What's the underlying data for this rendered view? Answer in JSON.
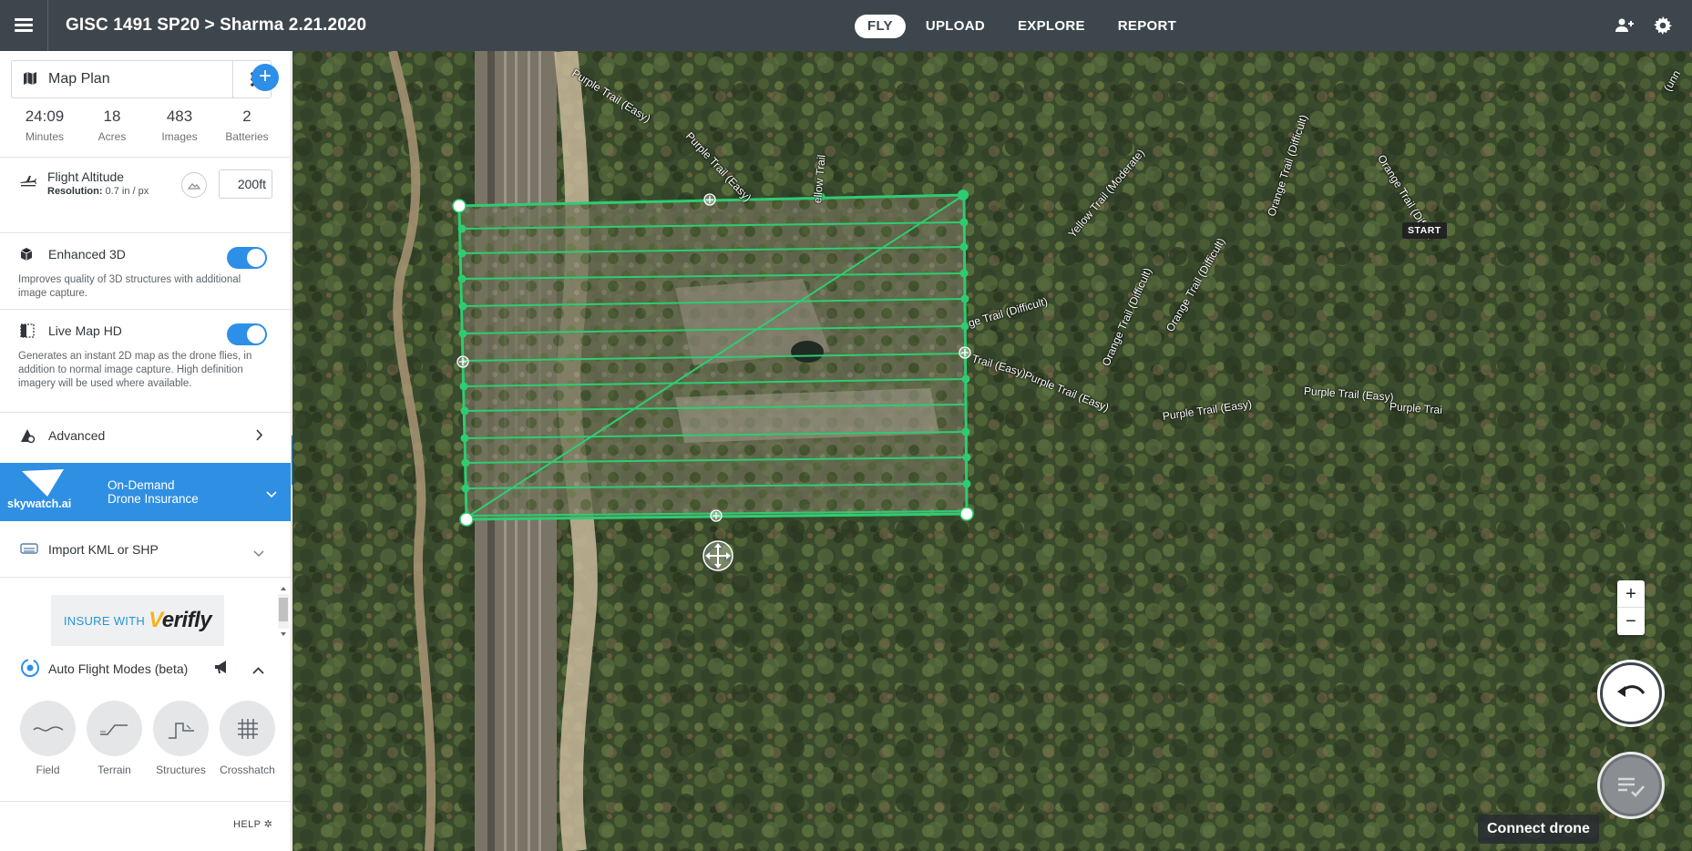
{
  "header": {
    "project_title": "GISC 1491 SP20 > Sharma 2.21.2020",
    "tabs": [
      {
        "label": "FLY",
        "active": true
      },
      {
        "label": "UPLOAD",
        "active": false
      },
      {
        "label": "EXPLORE",
        "active": false
      },
      {
        "label": "REPORT",
        "active": false
      }
    ],
    "icons": [
      "menu-icon",
      "team-icon",
      "gear-icon"
    ]
  },
  "sidebar": {
    "plan_name": "Map Plan",
    "stats": [
      {
        "value": "24:09",
        "label": "Minutes"
      },
      {
        "value": "18",
        "label": "Acres"
      },
      {
        "value": "483",
        "label": "Images"
      },
      {
        "value": "2",
        "label": "Batteries"
      }
    ],
    "altitude": {
      "title": "Flight Altitude",
      "resolution_label": "Resolution:",
      "resolution_value": "0.7 in / px",
      "value": "200ft"
    },
    "enhanced_3d": {
      "title": "Enhanced 3D",
      "enabled": true,
      "description": "Improves quality of 3D structures with additional image capture."
    },
    "live_map_hd": {
      "title": "Live Map HD",
      "enabled": true,
      "description": "Generates an instant 2D map as the drone flies, in addition to normal image capture. High definition imagery will be used where available."
    },
    "advanced_label": "Advanced",
    "insurance": {
      "brand": "skywatch.ai",
      "line1": "On-Demand",
      "line2": "Drone Insurance"
    },
    "import_label": "Import KML or SHP",
    "verifly": {
      "prefix": "INSURE WITH",
      "brand_v": "V",
      "brand_rest": "erifly"
    },
    "auto_flight": {
      "title": "Auto Flight Modes (beta)",
      "modes": [
        "Field",
        "Terrain",
        "Structures",
        "Crosshatch"
      ]
    },
    "help_label": "HELP"
  },
  "map": {
    "start_label": "START",
    "trail_labels": [
      "Purple Trail (Easy)",
      "Purple Trail (Easy)",
      "ellow Trail",
      "Yellow Trail (Moderate)",
      "Orange Trail (Difficult)",
      "Orange Trail (Difficu",
      "Orange Trail (Difficult)",
      "Orange Trail (Difficult)",
      "ge Trail (Difficult)",
      "Trail (Easy)",
      "Purple Trail (Easy)",
      "Purple Trail (Easy)",
      "Purple Trail (Easy)",
      "Purple Trai",
      "(unn"
    ],
    "zoom_in": "+",
    "zoom_out": "−",
    "connect_label": "Connect drone"
  },
  "colors": {
    "topbar": "#3e464d",
    "accent": "#2d8fe8",
    "flight_path": "#2ecc71"
  }
}
